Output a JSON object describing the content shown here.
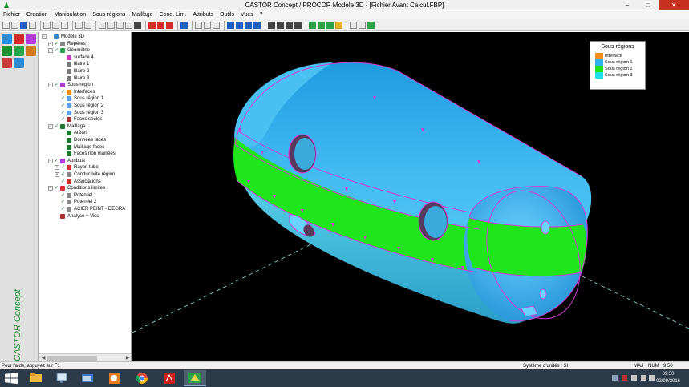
{
  "window": {
    "title": "CASTOR Concept / PROCOR Modèle 3D - [Fichier Avant Calcul.FBP]",
    "controls": {
      "minimize": "–",
      "maximize": "□",
      "close": "✕"
    }
  },
  "menu": {
    "items": [
      "Fichier",
      "Création",
      "Manipulation",
      "Sous-régions",
      "Maillage",
      "Cond. Lim.",
      "Attributs",
      "Outils",
      "Vues",
      "?"
    ]
  },
  "palette": {
    "brand": "CASTOR Concept"
  },
  "tree": {
    "nodes": [
      {
        "label": "Modèle 3D",
        "level": 0,
        "expander": "−",
        "checked": false,
        "icon_color": "#2a8bd8"
      },
      {
        "label": "Repères",
        "level": 1,
        "expander": "+",
        "checked": true,
        "icon_color": "#888888"
      },
      {
        "label": "Géométrie",
        "level": 1,
        "expander": "−",
        "checked": true,
        "icon_color": "#2aa34a"
      },
      {
        "label": "surface 4",
        "level": 2,
        "expander": "",
        "checked": false,
        "icon_color": "#c040c0"
      },
      {
        "label": "filaire 1",
        "level": 2,
        "expander": "",
        "checked": false,
        "icon_color": "#777777"
      },
      {
        "label": "filaire 2",
        "level": 2,
        "expander": "",
        "checked": false,
        "icon_color": "#777777"
      },
      {
        "label": "filaire 3",
        "level": 2,
        "expander": "",
        "checked": false,
        "icon_color": "#777777"
      },
      {
        "label": "Sous région",
        "level": 1,
        "expander": "−",
        "checked": true,
        "icon_color": "#b13cd8"
      },
      {
        "label": "Interfaces",
        "level": 2,
        "expander": "",
        "checked": true,
        "icon_color": "#f28c1c"
      },
      {
        "label": "Sous région 1",
        "level": 2,
        "expander": "",
        "checked": true,
        "icon_color": "#5a9ee6"
      },
      {
        "label": "Sous région 2",
        "level": 2,
        "expander": "",
        "checked": true,
        "icon_color": "#5a9ee6"
      },
      {
        "label": "Sous région 3",
        "level": 2,
        "expander": "",
        "checked": true,
        "icon_color": "#5a9ee6"
      },
      {
        "label": "Faces seules",
        "level": 2,
        "expander": "",
        "checked": true,
        "icon_color": "#a03030"
      },
      {
        "label": "Maillage",
        "level": 1,
        "expander": "−",
        "checked": true,
        "icon_color": "#1c7a2c"
      },
      {
        "label": "Arêtes",
        "level": 2,
        "expander": "",
        "checked": false,
        "icon_color": "#1c7a2c"
      },
      {
        "label": "Données faces",
        "level": 2,
        "expander": "",
        "checked": false,
        "icon_color": "#1c7a2c"
      },
      {
        "label": "Maillage faces",
        "level": 2,
        "expander": "",
        "checked": false,
        "icon_color": "#1c7a2c"
      },
      {
        "label": "Faces non maillées",
        "level": 2,
        "expander": "",
        "checked": false,
        "icon_color": "#1c7a2c"
      },
      {
        "label": "Attributs",
        "level": 1,
        "expander": "−",
        "checked": true,
        "icon_color": "#b13cd8"
      },
      {
        "label": "Rayon tube",
        "level": 2,
        "expander": "+",
        "checked": true,
        "icon_color": "#d03030"
      },
      {
        "label": "Conductivité région",
        "level": 2,
        "expander": "+",
        "checked": true,
        "icon_color": "#888888"
      },
      {
        "label": "Associations",
        "level": 2,
        "expander": "",
        "checked": true,
        "icon_color": "#d03030"
      },
      {
        "label": "Conditions limites",
        "level": 1,
        "expander": "−",
        "checked": true,
        "icon_color": "#d03030"
      },
      {
        "label": "Potentiel 1",
        "level": 2,
        "expander": "",
        "checked": true,
        "icon_color": "#888888"
      },
      {
        "label": "Potentiel 2",
        "level": 2,
        "expander": "",
        "checked": true,
        "icon_color": "#888888"
      },
      {
        "label": "ACIER PEINT - DEGRA",
        "level": 2,
        "expander": "",
        "checked": true,
        "icon_color": "#888888"
      },
      {
        "label": "Analyse + Visu",
        "level": 1,
        "expander": "",
        "checked": false,
        "icon_color": "#a03030"
      }
    ]
  },
  "legend": {
    "title": "Sous-régions",
    "items": [
      {
        "label": "Interface",
        "color": "#f28c1c"
      },
      {
        "label": "Sous région 1",
        "color": "#30b4e8"
      },
      {
        "label": "Sous région 2",
        "color": "#22e21c"
      },
      {
        "label": "Sous région 3",
        "color": "#1fe0e8"
      }
    ]
  },
  "scene": {
    "colors": {
      "tank_top": "#39b6ee",
      "band": "#1fe61a",
      "outline": "#d13bd6",
      "axes": "#7fd4d9"
    }
  },
  "status": {
    "help": "Pour l'aide, appuyez sur F1",
    "units": "Système d'unités : SI",
    "caps": "MAJ",
    "num": "NUM",
    "time": "9:50"
  },
  "taskbar": {
    "clock_time": "09:50",
    "clock_date": "02/09/2016"
  }
}
